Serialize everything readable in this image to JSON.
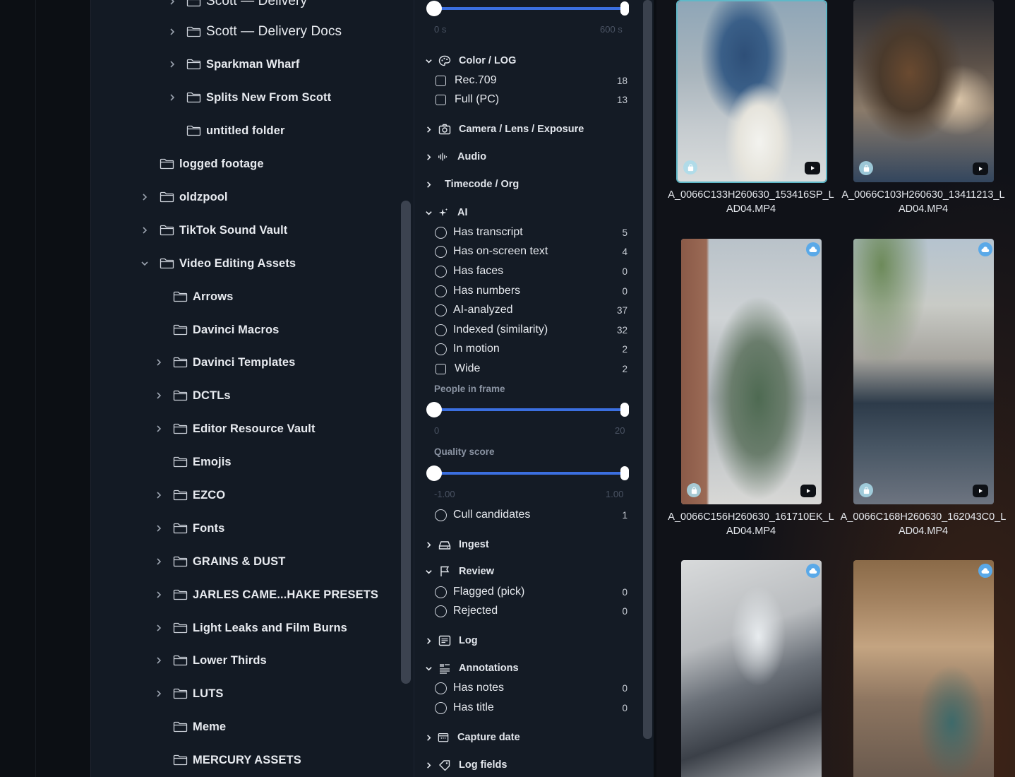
{
  "folders": [
    {
      "label": "Scott — Delivery",
      "light": true
    },
    {
      "label": "Scott — Delivery Docs",
      "light": true
    },
    {
      "label": "Sparkman Wharf"
    },
    {
      "label": "Splits New From Scott"
    },
    {
      "label": "untitled folder"
    },
    {
      "label": "logged footage"
    },
    {
      "label": "oldzpool"
    },
    {
      "label": "TikTok Sound Vault"
    },
    {
      "label": "Video Editing Assets"
    },
    {
      "label": "Arrows"
    },
    {
      "label": "Davinci Macros"
    },
    {
      "label": "Davinci Templates"
    },
    {
      "label": "DCTLs"
    },
    {
      "label": "Editor Resource Vault"
    },
    {
      "label": "Emojis"
    },
    {
      "label": "EZCO"
    },
    {
      "label": "Fonts"
    },
    {
      "label": "GRAINS & DUST"
    },
    {
      "label": "JARLES CAME...HAKE PRESETS"
    },
    {
      "label": "Light Leaks and Film Burns"
    },
    {
      "label": "Lower Thirds"
    },
    {
      "label": "LUTS"
    },
    {
      "label": "Meme"
    },
    {
      "label": "MERCURY ASSETS"
    }
  ],
  "filters": {
    "duration": {
      "min": "0 s",
      "max": "600 s",
      "low": 0,
      "high": 1
    },
    "sections": {
      "color": "Color / LOG",
      "camera": "Camera / Lens / Exposure",
      "audio": "Audio",
      "timecode": "Timecode / Org",
      "ai": "AI",
      "ingest": "Ingest",
      "review": "Review",
      "log": "Log",
      "annotations": "Annotations",
      "capture": "Capture date",
      "logfields": "Log fields"
    },
    "color_options": [
      {
        "label": "Rec.709",
        "count": "18"
      },
      {
        "label": "Full (PC)",
        "count": "13"
      }
    ],
    "ai_options": [
      {
        "label": "Has transcript",
        "count": "5"
      },
      {
        "label": "Has on-screen text",
        "count": "4"
      },
      {
        "label": "Has faces",
        "count": "0"
      },
      {
        "label": "Has numbers",
        "count": "0"
      },
      {
        "label": "AI-analyzed",
        "count": "37"
      },
      {
        "label": "Indexed (similarity)",
        "count": "32"
      },
      {
        "label": "In motion",
        "count": "2"
      },
      {
        "label": "Wide",
        "count": "2"
      }
    ],
    "people": {
      "label": "People in frame",
      "min": "0",
      "max": "20",
      "low": 0,
      "high": 1
    },
    "quality": {
      "label": "Quality score",
      "min": "-1.00",
      "max": "1.00",
      "low": 0,
      "high": 1
    },
    "cull": {
      "label": "Cull candidates",
      "count": "1"
    },
    "review_options": [
      {
        "label": "Flagged (pick)",
        "count": "0"
      },
      {
        "label": "Rejected",
        "count": "0"
      }
    ],
    "annotation_options": [
      {
        "label": "Has notes",
        "count": "0"
      },
      {
        "label": "Has title",
        "count": "0"
      }
    ]
  },
  "clips": [
    {
      "name": "A_0066C133H260630_153416SP_LAD04.MP4"
    },
    {
      "name": "A_0066C103H260630_13411213_LAD04.MP4"
    },
    {
      "name": "A_0066C156H260630_161710EK_LAD04.MP4"
    },
    {
      "name": "A_0066C168H260630_162043C0_LAD04.MP4"
    }
  ],
  "colors": {
    "accent": "#3b6fe0",
    "selection": "#5fb8c8",
    "cloud": "#5aa9e8"
  }
}
